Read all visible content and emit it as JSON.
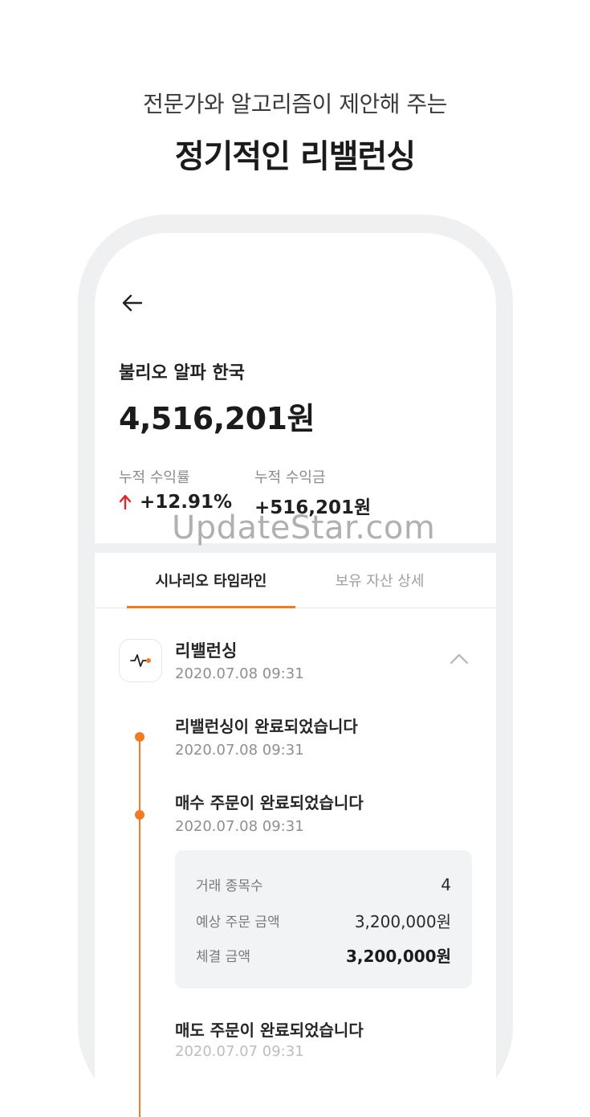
{
  "promo": {
    "subtitle": "전문가와 알고리즘이 제안해 주는",
    "title": "정기적인 리밸런싱"
  },
  "header": {
    "back_icon": "arrow-left-icon",
    "fund_name": "불리오 알파 한국",
    "balance": "4,516,201원"
  },
  "stats": {
    "rate_label": "누적 수익률",
    "rate_value": "+12.91%",
    "rate_arrow_color": "#e0262b",
    "profit_label": "누적 수익금",
    "profit_value": "+516,201원"
  },
  "watermark": "UpdateStar.com",
  "tabs": [
    {
      "label": "시나리오 타임라인",
      "active": true
    },
    {
      "label": "보유 자산 상세",
      "active": false
    }
  ],
  "accent_color": "#f47a21",
  "event": {
    "icon": "pulse-icon",
    "title": "리밸런싱",
    "date": "2020.07.08 09:31",
    "expand_icon": "chevron-up-icon"
  },
  "timeline": [
    {
      "title": "리밸런싱이 완료되었습니다",
      "date": "2020.07.08 09:31"
    },
    {
      "title": "매수 주문이 완료되었습니다",
      "date": "2020.07.08 09:31"
    },
    {
      "title": "매도 주문이 완료되었습니다",
      "date": "2020.07.07 09:31"
    }
  ],
  "order_detail": {
    "rows": [
      {
        "label": "거래 종목수",
        "value": "4"
      },
      {
        "label": "예상 주문 금액",
        "value": "3,200,000원"
      },
      {
        "label": "체결 금액",
        "value": "3,200,000원"
      }
    ]
  }
}
